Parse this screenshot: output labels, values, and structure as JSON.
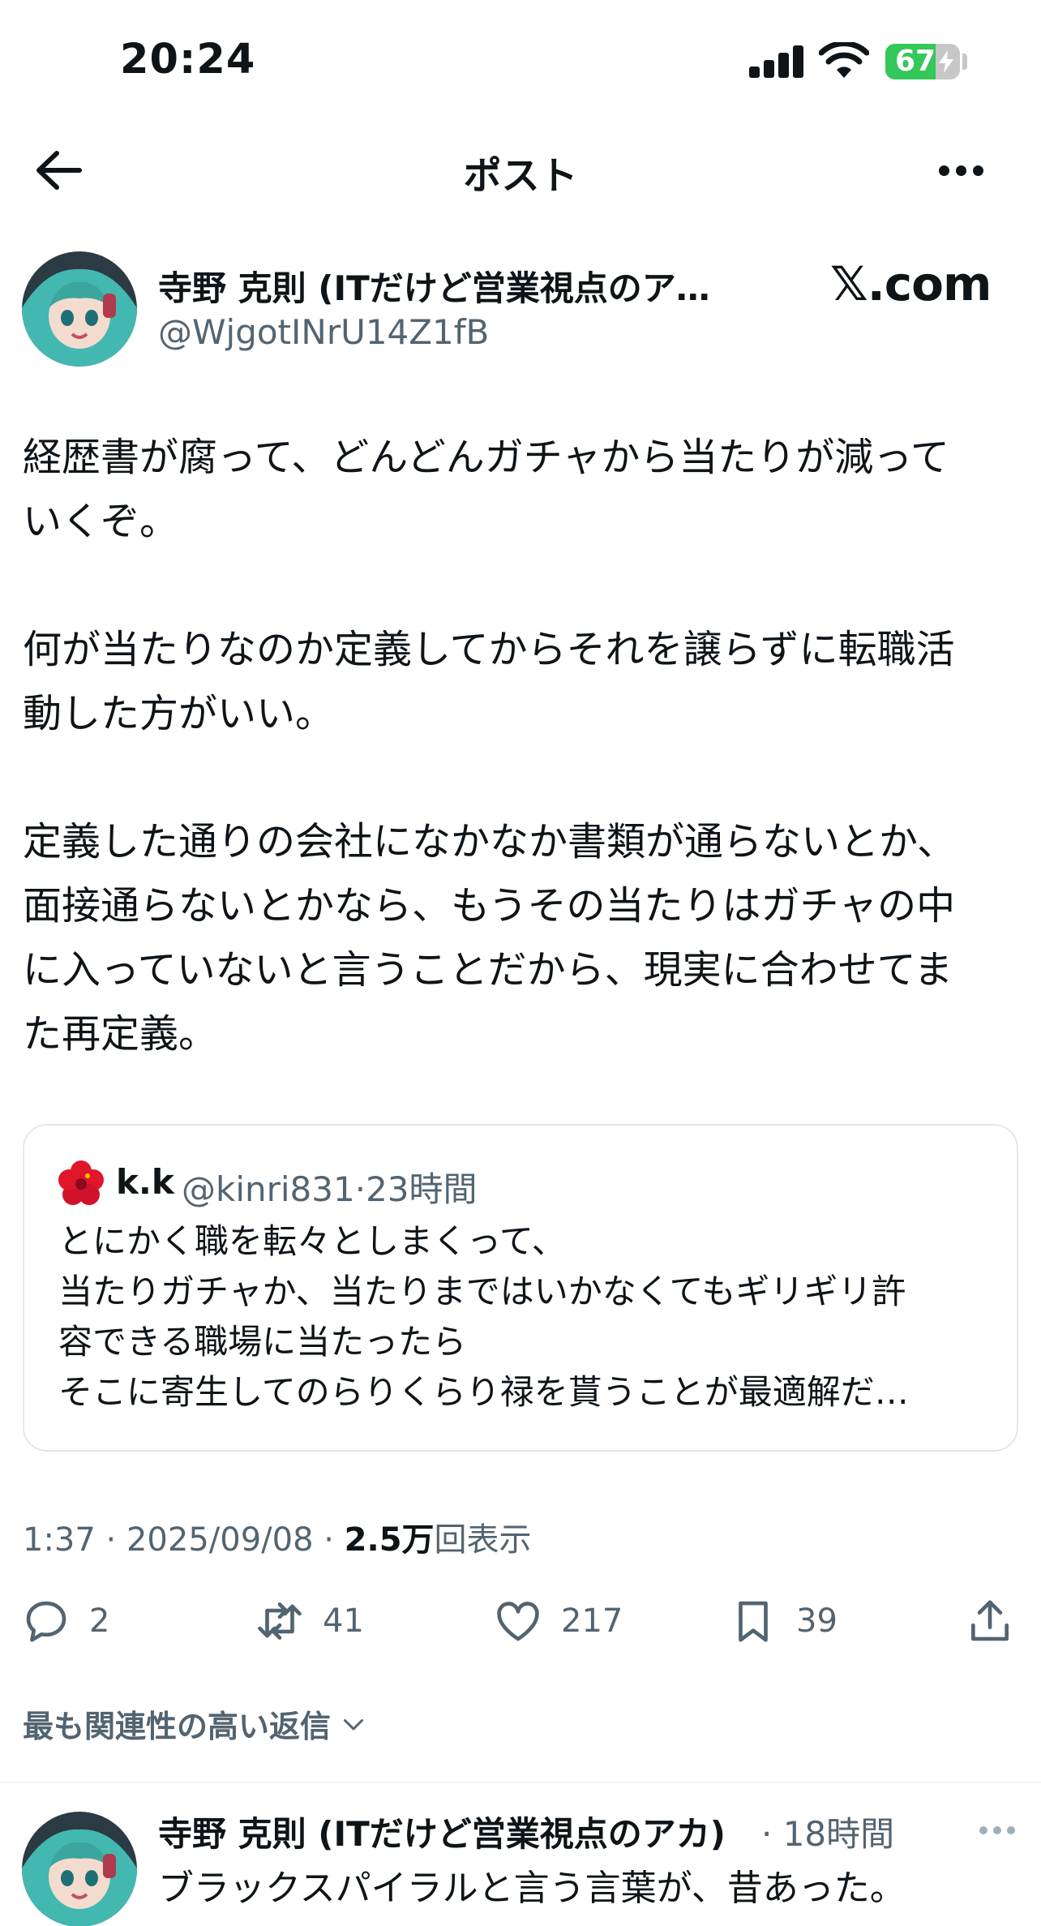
{
  "status_bar": {
    "time": "20:24",
    "battery_percent": "67",
    "battery_level": 0.67,
    "icons": [
      "signal-icon",
      "wifi-icon",
      "battery-icon",
      "charging-bolt-icon"
    ]
  },
  "header": {
    "title": "ポスト",
    "back_icon": "arrow-left-icon",
    "more_icon": "more-horizontal-icon"
  },
  "post": {
    "author_name": "寺野 克則 (ITだけど営業視点のア…",
    "author_handle": "@WjgotINrU14Z1fB",
    "watermark": "𝕏.com",
    "body": [
      "経歴書が腐って、どんどんガチャから当たりが減って",
      "いくぞ。",
      "",
      "何が当たりなのか定義してからそれを譲らずに転職活",
      "動した方がいい。",
      "",
      "定義した通りの会社になかなか書類が通らないとか、",
      "面接通らないとかなら、もうその当たりはガチャの中",
      "に入っていないと言うことだから、現実に合わせてま",
      "た再定義。"
    ],
    "quote": {
      "avatar_icon": "hibiscus-icon",
      "name": "k.k",
      "handle": "@kinri831",
      "separator": "·",
      "time": "23時間",
      "lines": [
        "とにかく職を転々としまくって、",
        "当たりガチャか、当たりまではいかなくてもギリギリ許",
        "容できる職場に当たったら",
        "そこに寄生してのらりくらり禄を貰うことが最適解だ…"
      ]
    },
    "timestamp": "1:37 · 2025/09/08 · ",
    "views_count": "2.5万",
    "views_label": "回表示",
    "actions": {
      "reply": {
        "icon": "reply-icon",
        "count": "2"
      },
      "repost": {
        "icon": "repost-icon",
        "count": "41"
      },
      "like": {
        "icon": "heart-icon",
        "count": "217"
      },
      "bookmark": {
        "icon": "bookmark-icon",
        "count": "39"
      },
      "share": {
        "icon": "share-icon"
      }
    }
  },
  "replies_sort": {
    "label": "最も関連性の高い返信",
    "icon": "chevron-down-icon"
  },
  "reply": {
    "author_name": "寺野 克則 (ITだけど営業視点のアカ)",
    "time": "· 18時間",
    "text": "ブラックスパイラルと言う言葉が、昔あった。",
    "more_icon": "more-horizontal-icon"
  },
  "colors": {
    "text_primary": "#0f1419",
    "text_secondary": "#536471",
    "battery_green": "#34c759",
    "border": "#e1e8ed"
  }
}
